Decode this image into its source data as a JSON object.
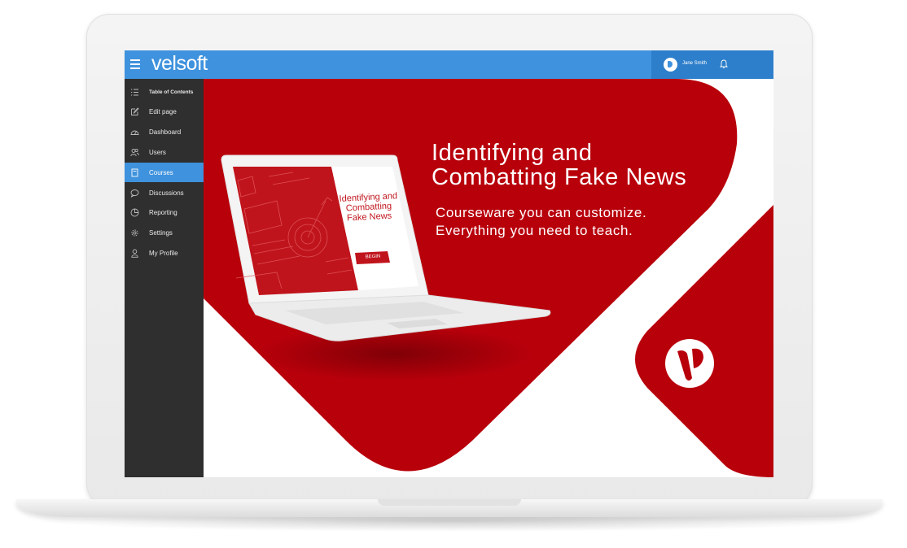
{
  "app": {
    "brand": "velsoft"
  },
  "header": {
    "user_name": "Jane Smith"
  },
  "sidebar": {
    "items": [
      {
        "label": "Table of Contents",
        "icon": "list-icon",
        "active": false
      },
      {
        "label": "Edit page",
        "icon": "edit-icon",
        "active": false
      },
      {
        "label": "Dashboard",
        "icon": "dashboard-icon",
        "active": false
      },
      {
        "label": "Users",
        "icon": "users-icon",
        "active": false
      },
      {
        "label": "Courses",
        "icon": "book-icon",
        "active": true
      },
      {
        "label": "Discussions",
        "icon": "chat-icon",
        "active": false
      },
      {
        "label": "Reporting",
        "icon": "pie-chart-icon",
        "active": false
      },
      {
        "label": "Settings",
        "icon": "gear-icon",
        "active": false
      },
      {
        "label": "My Profile",
        "icon": "user-icon",
        "active": false
      }
    ]
  },
  "hero": {
    "title_line1": "Identifying and",
    "title_line2": "Combatting Fake News",
    "subtitle_line1": "Courseware you can customize.",
    "subtitle_line2": "Everything you need to teach.",
    "mini_title_line1": "Identifying and",
    "mini_title_line2": "Combatting",
    "mini_title_line3": "Fake News",
    "mini_button": "BEGIN"
  },
  "colors": {
    "topbar": "#3f92dd",
    "sidebar": "#2f2f2f",
    "brand_red": "#b8000b",
    "active": "#3f92dd"
  }
}
